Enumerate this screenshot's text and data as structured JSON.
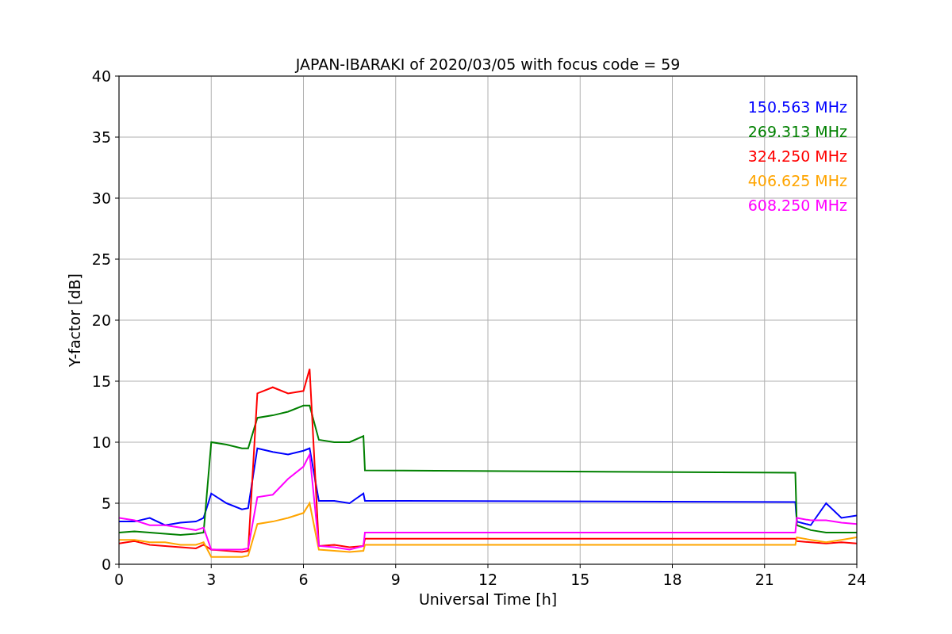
{
  "figure": {
    "chart_data": {
      "type": "line",
      "title": "JAPAN-IBARAKI of 2020/03/05 with focus code = 59",
      "xlabel": "Universal Time [h]",
      "ylabel": "Y-factor [dB]",
      "x": [
        0,
        0.5,
        1,
        1.5,
        2,
        2.5,
        2.75,
        3,
        3.5,
        4,
        4.2,
        4.5,
        5,
        5.5,
        6,
        6.2,
        6.5,
        7,
        7.5,
        7.95,
        8,
        22,
        22.05,
        22.5,
        23,
        23.5,
        24
      ],
      "series": [
        {
          "name": "150.563 MHz",
          "color": "#0000ff",
          "values": [
            3.5,
            3.5,
            3.8,
            3.2,
            3.4,
            3.5,
            3.8,
            5.8,
            5,
            4.5,
            4.6,
            9.5,
            9.2,
            9,
            9.3,
            9.5,
            5.2,
            5.2,
            5,
            5.8,
            5.2,
            5.1,
            3.5,
            3.2,
            5,
            3.8,
            4
          ]
        },
        {
          "name": "269.313 MHz",
          "color": "#008000",
          "values": [
            2.6,
            2.7,
            2.6,
            2.5,
            2.4,
            2.5,
            2.6,
            10,
            9.8,
            9.5,
            9.5,
            12,
            12.2,
            12.5,
            13,
            13,
            10.2,
            10,
            10,
            10.5,
            7.7,
            7.5,
            3.2,
            2.8,
            2.6,
            2.6,
            2.6
          ]
        },
        {
          "name": "324.250 MHz",
          "color": "#ff0000",
          "values": [
            1.7,
            1.9,
            1.6,
            1.5,
            1.4,
            1.3,
            1.6,
            1.2,
            1.1,
            1,
            1.1,
            14,
            14.5,
            14,
            14.2,
            16,
            1.5,
            1.6,
            1.4,
            1.5,
            2.1,
            2.1,
            1.9,
            1.8,
            1.7,
            1.8,
            1.7
          ]
        },
        {
          "name": "406.625 MHz",
          "color": "#ffa500",
          "values": [
            2,
            2,
            1.8,
            1.8,
            1.6,
            1.6,
            1.8,
            0.6,
            0.6,
            0.6,
            0.7,
            3.3,
            3.5,
            3.8,
            4.2,
            5,
            1.2,
            1.1,
            1,
            1.1,
            1.6,
            1.6,
            2.2,
            2,
            1.8,
            2,
            2.2
          ]
        },
        {
          "name": "608.250 MHz",
          "color": "#ff00ff",
          "values": [
            3.8,
            3.6,
            3.2,
            3.2,
            3,
            2.8,
            3,
            1.2,
            1.2,
            1.2,
            1.3,
            5.5,
            5.7,
            7,
            8,
            9,
            1.5,
            1.4,
            1.2,
            1.5,
            2.6,
            2.6,
            3.8,
            3.6,
            3.6,
            3.4,
            3.3
          ]
        }
      ],
      "xlim": [
        0,
        24
      ],
      "ylim": [
        0,
        40
      ],
      "xticks": [
        0,
        3,
        6,
        9,
        12,
        15,
        18,
        21,
        24
      ],
      "yticks": [
        0,
        5,
        10,
        15,
        20,
        25,
        30,
        35,
        40
      ],
      "grid": true
    }
  }
}
